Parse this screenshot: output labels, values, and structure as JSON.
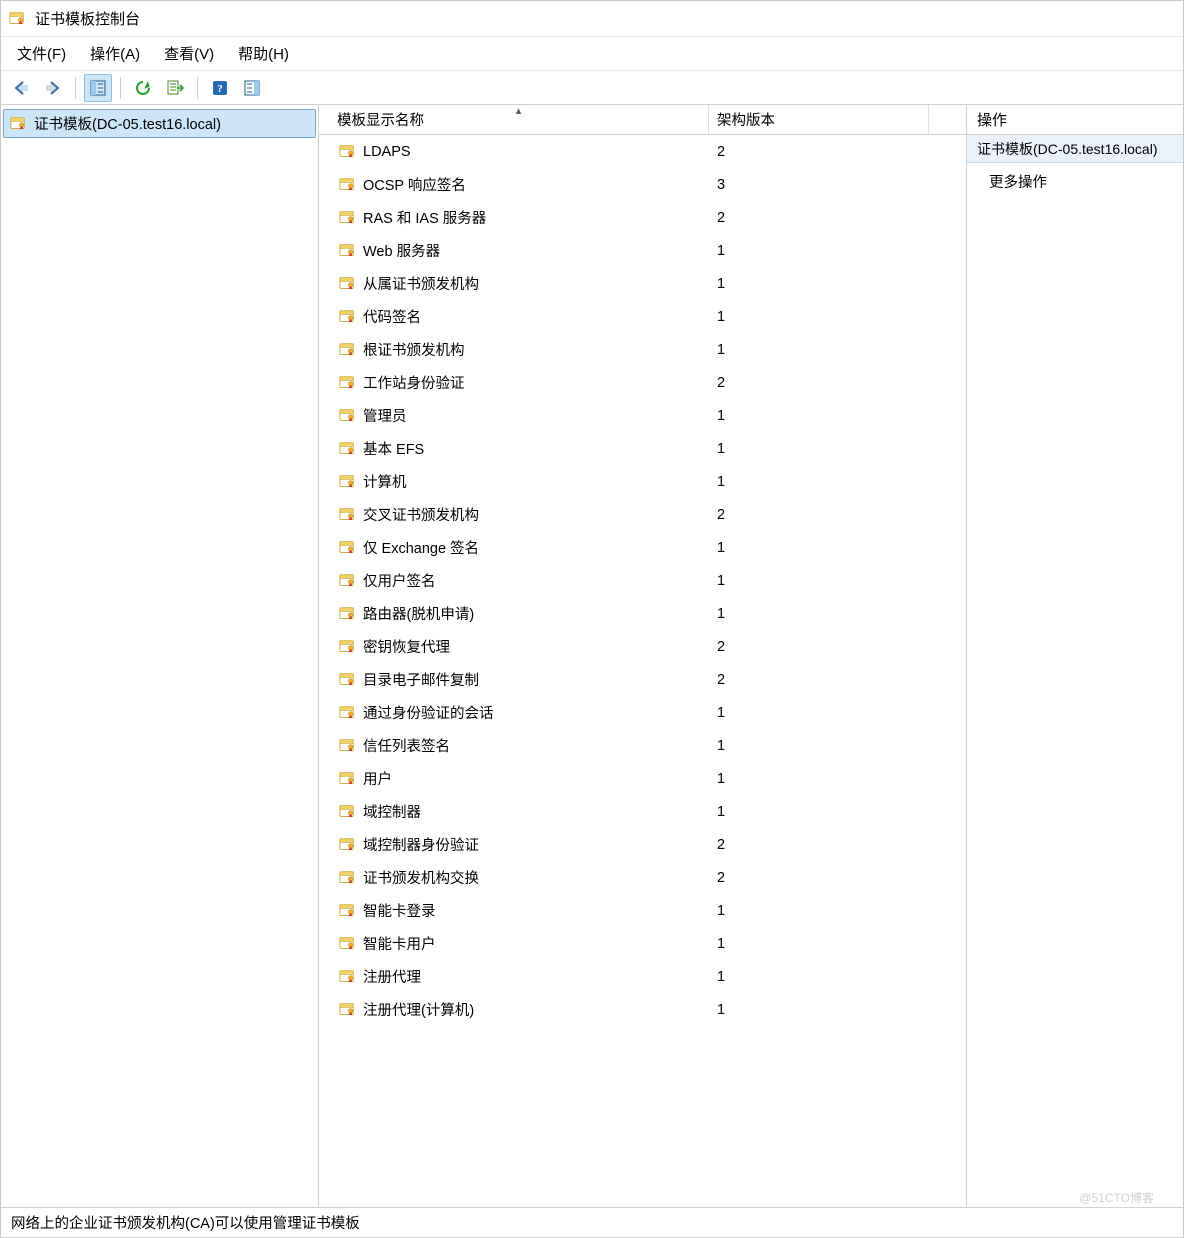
{
  "window": {
    "title": "证书模板控制台"
  },
  "menubar": {
    "file": "文件(F)",
    "action": "操作(A)",
    "view": "查看(V)",
    "help": "帮助(H)"
  },
  "tree": {
    "root": "证书模板(DC-05.test16.local)"
  },
  "columns": {
    "name": "模板显示名称",
    "version": "架构版本"
  },
  "templates": [
    {
      "name": "LDAPS",
      "version": "2"
    },
    {
      "name": "OCSP 响应签名",
      "version": "3"
    },
    {
      "name": "RAS 和 IAS 服务器",
      "version": "2"
    },
    {
      "name": "Web 服务器",
      "version": "1"
    },
    {
      "name": "从属证书颁发机构",
      "version": "1"
    },
    {
      "name": "代码签名",
      "version": "1"
    },
    {
      "name": "根证书颁发机构",
      "version": "1"
    },
    {
      "name": "工作站身份验证",
      "version": "2"
    },
    {
      "name": "管理员",
      "version": "1"
    },
    {
      "name": "基本 EFS",
      "version": "1"
    },
    {
      "name": "计算机",
      "version": "1"
    },
    {
      "name": "交叉证书颁发机构",
      "version": "2"
    },
    {
      "name": "仅 Exchange 签名",
      "version": "1"
    },
    {
      "name": "仅用户签名",
      "version": "1"
    },
    {
      "name": "路由器(脱机申请)",
      "version": "1"
    },
    {
      "name": "密钥恢复代理",
      "version": "2"
    },
    {
      "name": "目录电子邮件复制",
      "version": "2"
    },
    {
      "name": "通过身份验证的会话",
      "version": "1"
    },
    {
      "name": "信任列表签名",
      "version": "1"
    },
    {
      "name": "用户",
      "version": "1"
    },
    {
      "name": "域控制器",
      "version": "1"
    },
    {
      "name": "域控制器身份验证",
      "version": "2"
    },
    {
      "name": "证书颁发机构交换",
      "version": "2"
    },
    {
      "name": "智能卡登录",
      "version": "1"
    },
    {
      "name": "智能卡用户",
      "version": "1"
    },
    {
      "name": "注册代理",
      "version": "1"
    },
    {
      "name": "注册代理(计算机)",
      "version": "1"
    }
  ],
  "actions": {
    "title": "操作",
    "group": "证书模板(DC-05.test16.local)",
    "more": "更多操作"
  },
  "statusbar": {
    "text": "网络上的企业证书颁发机构(CA)可以使用管理证书模板"
  },
  "watermark": "@51CTO博客"
}
